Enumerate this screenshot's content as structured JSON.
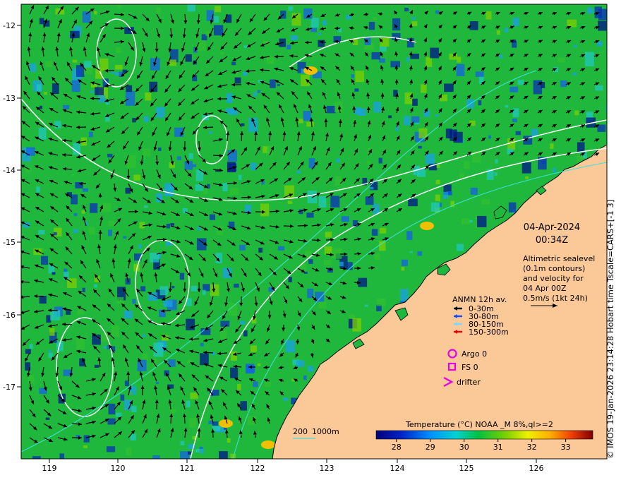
{
  "map": {
    "lon_ticks": [
      "119",
      "120",
      "121",
      "122",
      "123",
      "124",
      "125",
      "126"
    ],
    "lat_ticks": [
      "-12",
      "-13",
      "-14",
      "-15",
      "-16",
      "-17"
    ],
    "date": "04-Apr-2024",
    "time": "00:34Z",
    "altimetry_lines": [
      "Altimetric sealevel",
      "(0.1m contours)",
      "and velocity for",
      "04 Apr 00Z",
      "0.5m/s (1kt 24h)"
    ],
    "anmn": {
      "title": "ANMN 12h av.",
      "items": [
        {
          "label": "0-30m",
          "color": "#000000"
        },
        {
          "label": "30-80m",
          "color": "#1a4cff"
        },
        {
          "label": "80-150m",
          "color": "#7fd6ff"
        },
        {
          "label": "150-300m",
          "color": "#e60000"
        }
      ]
    },
    "argo_label": "Argo 0",
    "fs_label": "FS 0",
    "drifter_label": "drifter",
    "marker_color": "#e600e6",
    "depth_legend": {
      "label_200": "200",
      "label_1000": "1000m"
    },
    "colorbar": {
      "title": "Temperature (°C) NOAA _M 8%,ql>=2",
      "ticks": [
        "28",
        "29",
        "30",
        "31",
        "32",
        "33"
      ],
      "min": 27.4,
      "max": 33.8
    },
    "credit": "© IMOS 19-Jan-2026 23:14:28 Hobart time Tscale=CARS+[-1 3]",
    "land_color": "#fbc898"
  }
}
